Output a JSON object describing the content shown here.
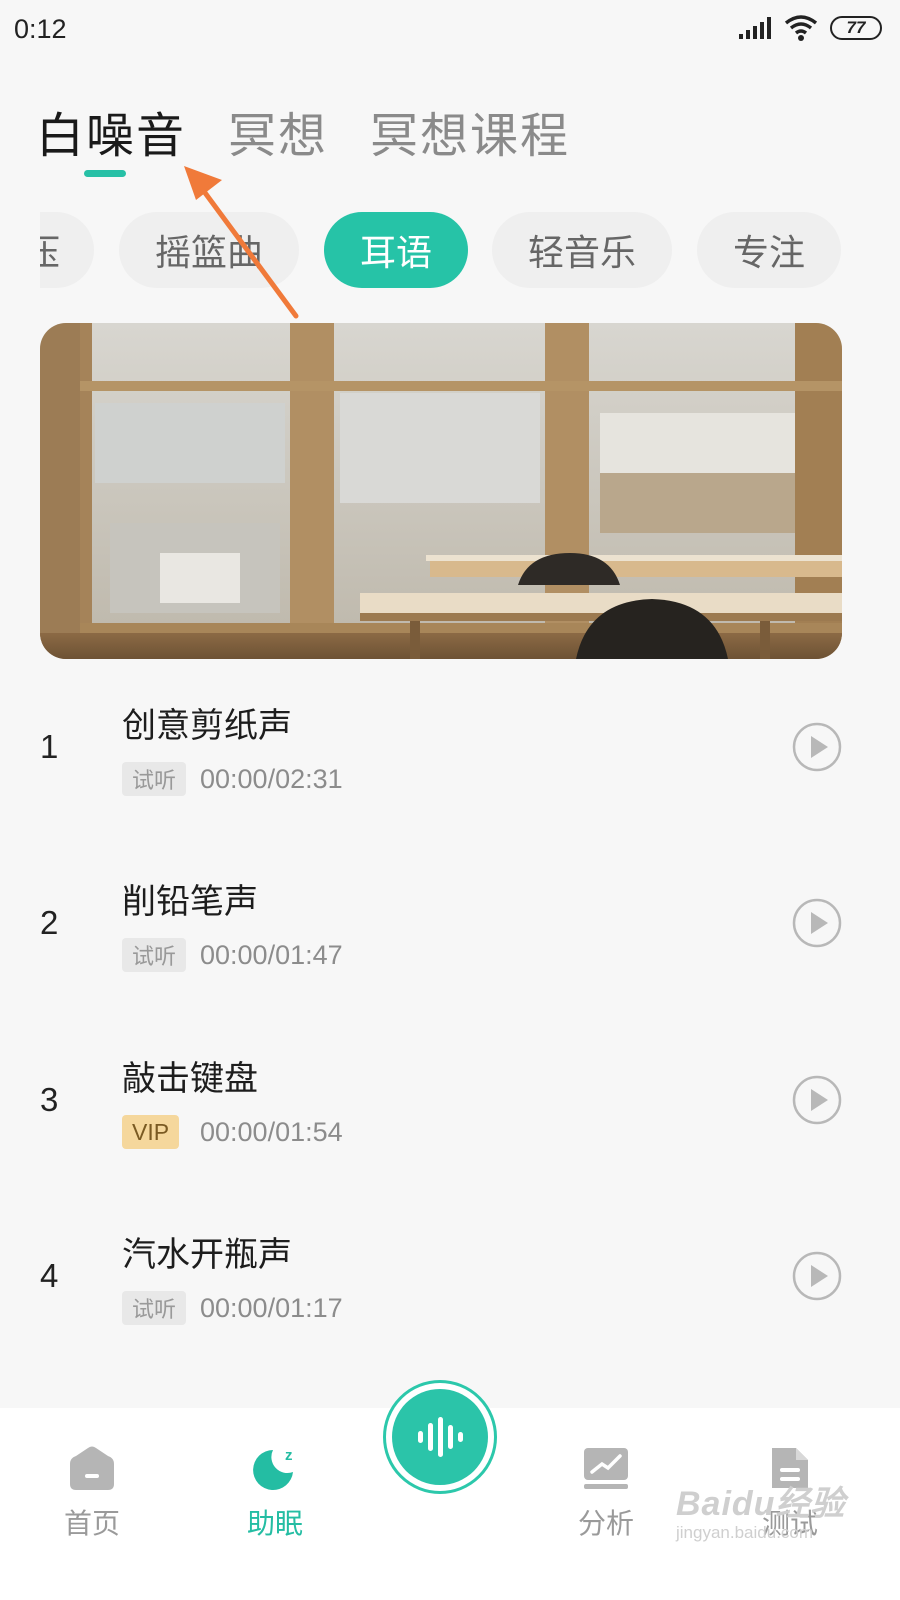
{
  "status_bar": {
    "time": "0:12",
    "battery": "77"
  },
  "main_tabs": [
    {
      "label": "白噪音",
      "active": true
    },
    {
      "label": "冥想",
      "active": false
    },
    {
      "label": "冥想课程",
      "active": false
    }
  ],
  "categories": [
    {
      "label": "压",
      "active": false
    },
    {
      "label": "摇篮曲",
      "active": false
    },
    {
      "label": "耳语",
      "active": true
    },
    {
      "label": "轻音乐",
      "active": false
    },
    {
      "label": "专注",
      "active": false
    }
  ],
  "tracks": [
    {
      "number": "1",
      "title": "创意剪纸声",
      "badge": "试听",
      "duration": "00:00/02:31"
    },
    {
      "number": "2",
      "title": "削铅笔声",
      "badge": "试听",
      "duration": "00:00/01:47"
    },
    {
      "number": "3",
      "title": "敲击键盘",
      "badge": "VIP",
      "duration": "00:00/01:54"
    },
    {
      "number": "4",
      "title": "汽水开瓶声",
      "badge": "试听",
      "duration": "00:00/01:17"
    }
  ],
  "bottom_nav": [
    {
      "label": "首页",
      "icon": "home-icon",
      "active": false
    },
    {
      "label": "助眠",
      "icon": "moon-sleep-icon",
      "active": true
    },
    {
      "label": "分析",
      "icon": "analysis-icon",
      "active": false
    },
    {
      "label": "测试",
      "icon": "test-document-icon",
      "active": false
    }
  ],
  "center_button": {
    "icon": "soundwave-icon"
  },
  "watermark": {
    "main": "Baidu经验",
    "sub": "jingyan.baidu.com"
  },
  "colors": {
    "accent": "#26c3a7",
    "vip": "#f5d79c",
    "annotation_arrow": "#f07a3a"
  }
}
